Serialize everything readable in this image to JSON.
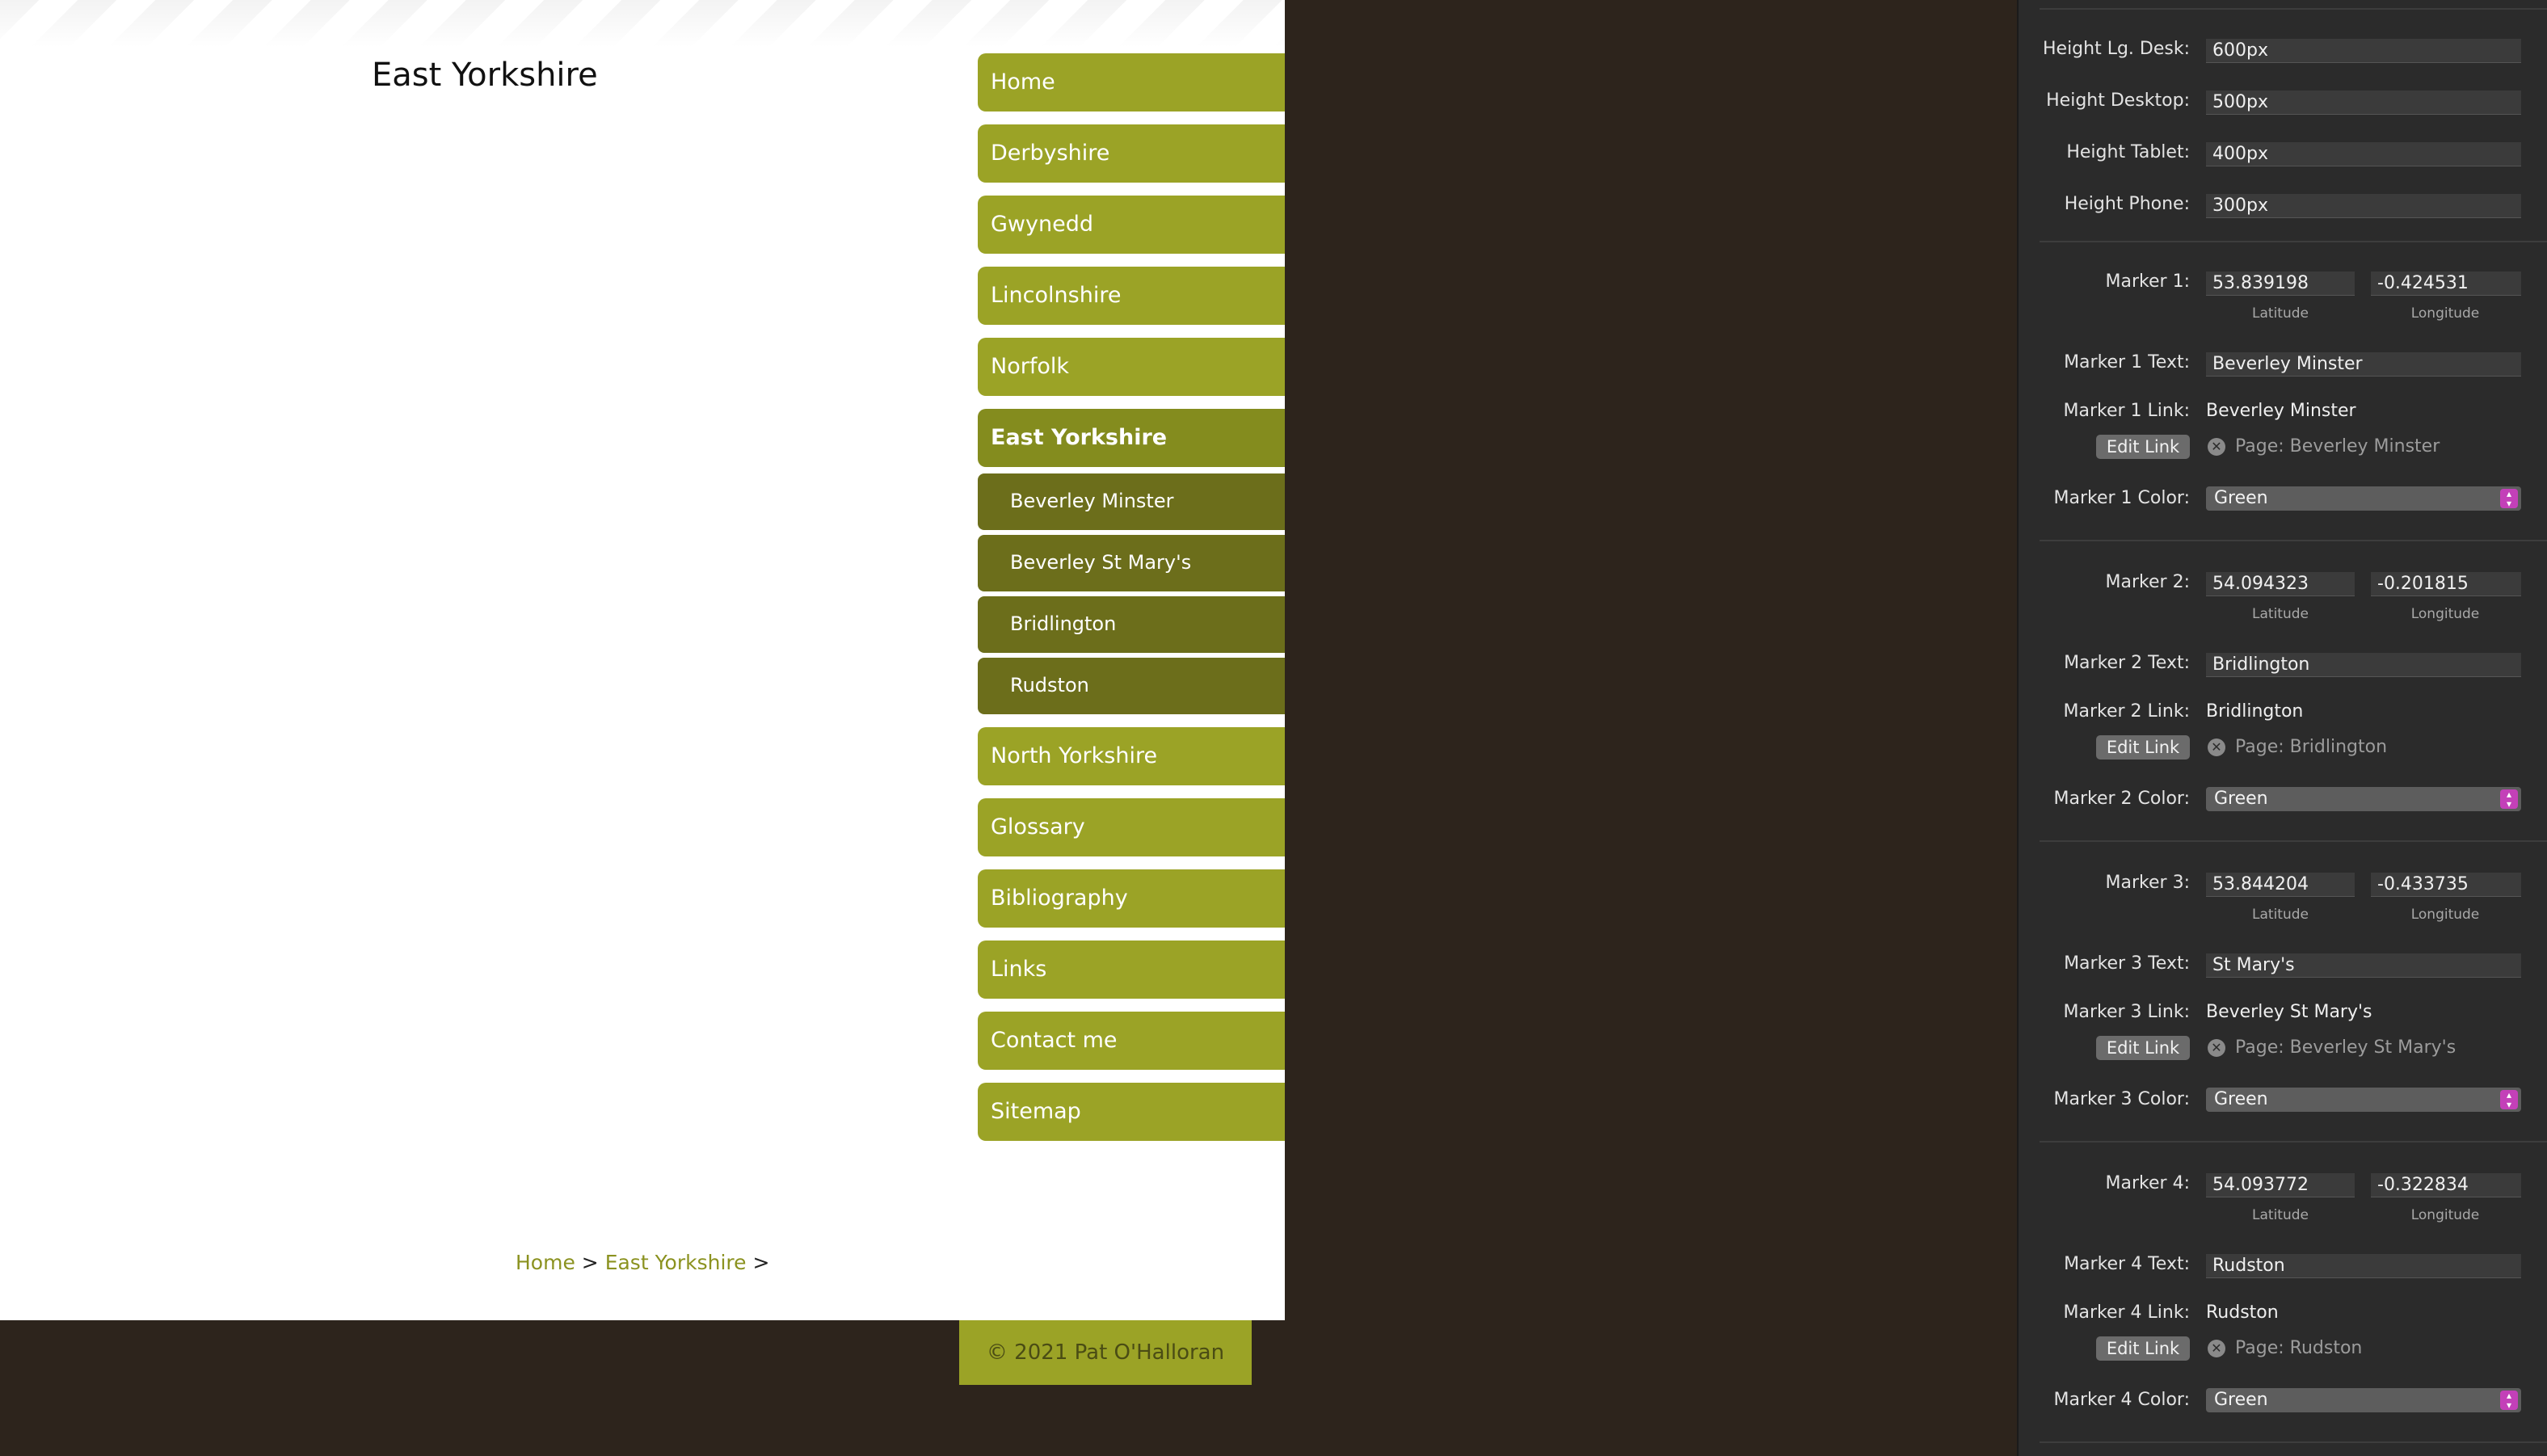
{
  "site": {
    "page_title": "East Yorkshire",
    "nav": {
      "items_before": [
        "Home",
        "Derbyshire",
        "Gwynedd",
        "Lincolnshire",
        "Norfolk"
      ],
      "active": "East Yorkshire",
      "sub_items": [
        "Beverley Minster",
        "Beverley St Mary's",
        "Bridlington",
        "Rudston"
      ],
      "items_after": [
        "North Yorkshire",
        "Glossary",
        "Bibliography",
        "Links",
        "Contact me",
        "Sitemap"
      ]
    },
    "breadcrumb": {
      "home": "Home",
      "sep": ">",
      "current": "East Yorkshire"
    },
    "footer": "© 2021 Pat O'Halloran"
  },
  "inspector": {
    "heights": [
      {
        "label": "Height Lg. Desk:",
        "value": "600px"
      },
      {
        "label": "Height Desktop:",
        "value": "500px"
      },
      {
        "label": "Height Tablet:",
        "value": "400px"
      },
      {
        "label": "Height Phone:",
        "value": "300px"
      }
    ],
    "latitude_label": "Latitude",
    "longitude_label": "Longitude",
    "edit_link_label": "Edit Link",
    "markers": [
      {
        "label": "Marker 1:",
        "lat": "53.839198",
        "lon": "-0.424531",
        "text_label": "Marker 1 Text:",
        "text": "Beverley Minster",
        "link_label": "Marker 1 Link:",
        "link": "Beverley Minster",
        "page": "Page: Beverley Minster",
        "color_label": "Marker 1 Color:",
        "color": "Green"
      },
      {
        "label": "Marker 2:",
        "lat": "54.094323",
        "lon": "-0.201815",
        "text_label": "Marker 2 Text:",
        "text": "Bridlington",
        "link_label": "Marker 2 Link:",
        "link": "Bridlington",
        "page": "Page: Bridlington",
        "color_label": "Marker 2 Color:",
        "color": "Green"
      },
      {
        "label": "Marker 3:",
        "lat": "53.844204",
        "lon": "-0.433735",
        "text_label": "Marker 3 Text:",
        "text": "St Mary's",
        "link_label": "Marker 3 Link:",
        "link": "Beverley St Mary's",
        "page": "Page: Beverley St Mary's",
        "color_label": "Marker 3 Color:",
        "color": "Green"
      },
      {
        "label": "Marker 4:",
        "lat": "54.093772",
        "lon": "-0.322834",
        "text_label": "Marker 4 Text:",
        "text": "Rudston",
        "link_label": "Marker 4 Link:",
        "link": "Rudston",
        "page": "Page: Rudston",
        "color_label": "Marker 4 Color:",
        "color": "Green"
      }
    ]
  }
}
